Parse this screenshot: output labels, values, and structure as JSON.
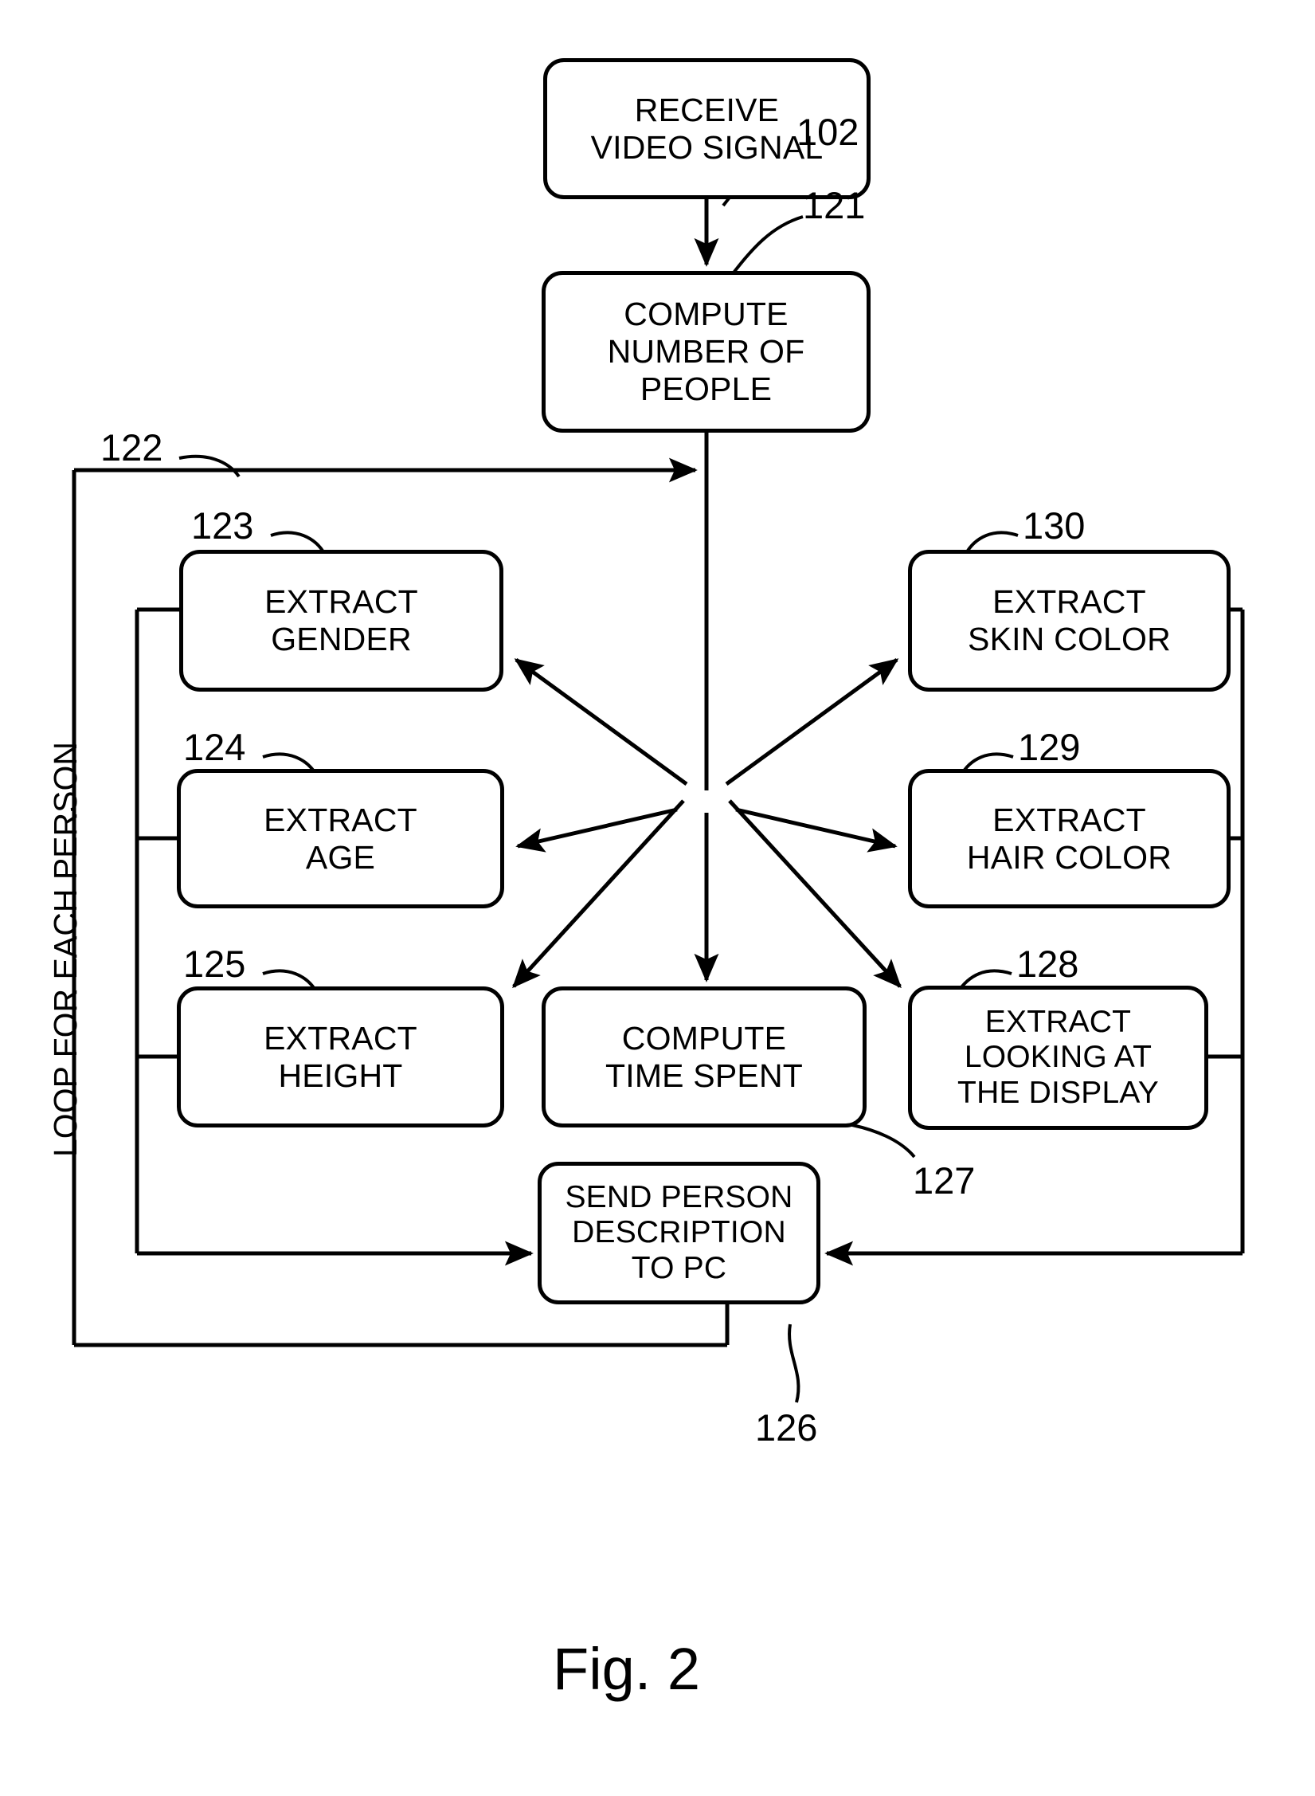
{
  "figure": {
    "caption": "Fig. 2",
    "loop_label": "LOOP FOR EACH PERSON"
  },
  "boxes": [
    {
      "id": "receive-video-signal",
      "label": "RECEIVE\nVIDEO SIGNAL"
    },
    {
      "id": "compute-number-of-people",
      "label": "COMPUTE\nNUMBER OF\nPEOPLE"
    },
    {
      "id": "extract-gender",
      "label": "EXTRACT\nGENDER"
    },
    {
      "id": "extract-age",
      "label": "EXTRACT\nAGE"
    },
    {
      "id": "extract-height",
      "label": "EXTRACT\nHEIGHT"
    },
    {
      "id": "compute-time-spent",
      "label": "COMPUTE\nTIME SPENT"
    },
    {
      "id": "extract-looking-at-display",
      "label": "EXTRACT\nLOOKING AT\nTHE DISPLAY"
    },
    {
      "id": "extract-hair-color",
      "label": "EXTRACT\nHAIR COLOR"
    },
    {
      "id": "extract-skin-color",
      "label": "EXTRACT\nSKIN COLOR"
    },
    {
      "id": "send-person-description",
      "label": "SEND PERSON\nDESCRIPTION\nTO PC"
    }
  ],
  "reference_numerals": [
    {
      "id": "ref-102",
      "value": "102"
    },
    {
      "id": "ref-121",
      "value": "121"
    },
    {
      "id": "ref-122",
      "value": "122"
    },
    {
      "id": "ref-123",
      "value": "123"
    },
    {
      "id": "ref-124",
      "value": "124"
    },
    {
      "id": "ref-125",
      "value": "125"
    },
    {
      "id": "ref-126",
      "value": "126"
    },
    {
      "id": "ref-127",
      "value": "127"
    },
    {
      "id": "ref-128",
      "value": "128"
    },
    {
      "id": "ref-129",
      "value": "129"
    },
    {
      "id": "ref-130",
      "value": "130"
    }
  ],
  "colors": {
    "ink": "#000000",
    "paper": "#ffffff"
  }
}
